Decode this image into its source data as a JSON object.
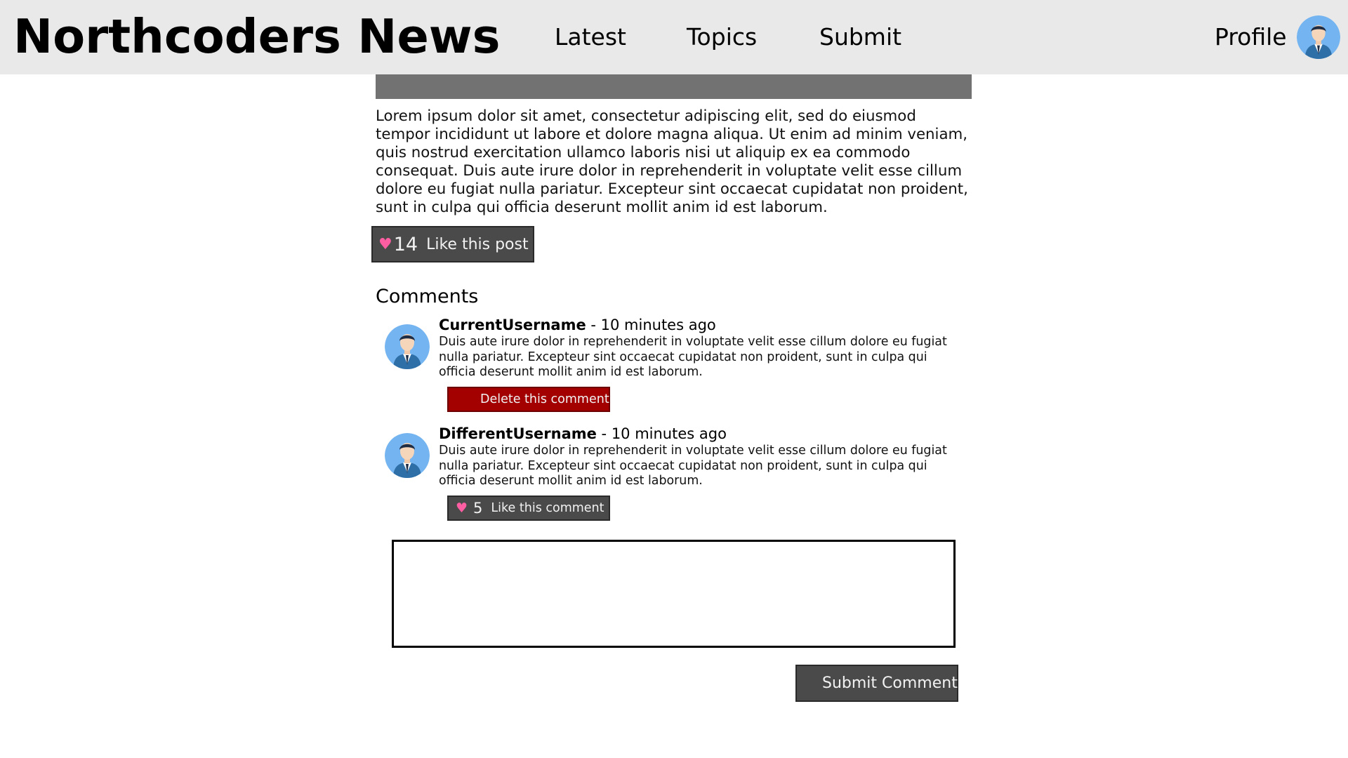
{
  "header": {
    "site_title": "Northcoders News",
    "nav": {
      "latest": "Latest",
      "topics": "Topics",
      "submit": "Submit",
      "profile": "Profile"
    }
  },
  "article": {
    "body": "Lorem ipsum dolor sit amet, consectetur adipiscing elit, sed do eiusmod tempor incididunt ut labore et dolore magna aliqua. Ut enim ad minim veniam, quis nostrud exercitation ullamco laboris nisi ut aliquip ex ea commodo consequat. Duis aute irure dolor in reprehenderit in voluptate velit esse cillum dolore eu fugiat nulla pariatur. Excepteur sint occaecat cupidatat non proident, sunt in culpa qui officia deserunt mollit anim id est laborum.",
    "like_count": "14",
    "like_label": "Like this post"
  },
  "comments": {
    "heading": "Comments",
    "items": [
      {
        "username": "CurrentUsername",
        "separator": " - ",
        "time": "10 minutes ago",
        "body": "Duis aute irure dolor in reprehenderit in voluptate velit esse cillum dolore eu fugiat nulla pariatur. Excepteur sint occaecat cupidatat non proident, sunt in culpa qui officia deserunt mollit anim id est laborum.",
        "action_label": "Delete this comment"
      },
      {
        "username": "DifferentUsername",
        "separator": " - ",
        "time": "10 minutes ago",
        "body": "Duis aute irure dolor in reprehenderit in voluptate velit esse cillum dolore eu fugiat nulla pariatur. Excepteur sint occaecat cupidatat non proident, sunt in culpa qui officia deserunt mollit anim id est laborum.",
        "like_count": "5",
        "action_label": "Like this comment"
      }
    ],
    "input_value": "",
    "submit_label": "Submit Comment"
  },
  "icons": {
    "heart": "heart-icon",
    "avatar": "user-avatar-icon"
  },
  "colors": {
    "header_bg": "#e9e9e9",
    "banner": "#727272",
    "button_dark": "#4a4a4a",
    "button_danger": "#a30000",
    "heart": "#ff5fa2",
    "avatar_bg": "#74b4f0"
  }
}
